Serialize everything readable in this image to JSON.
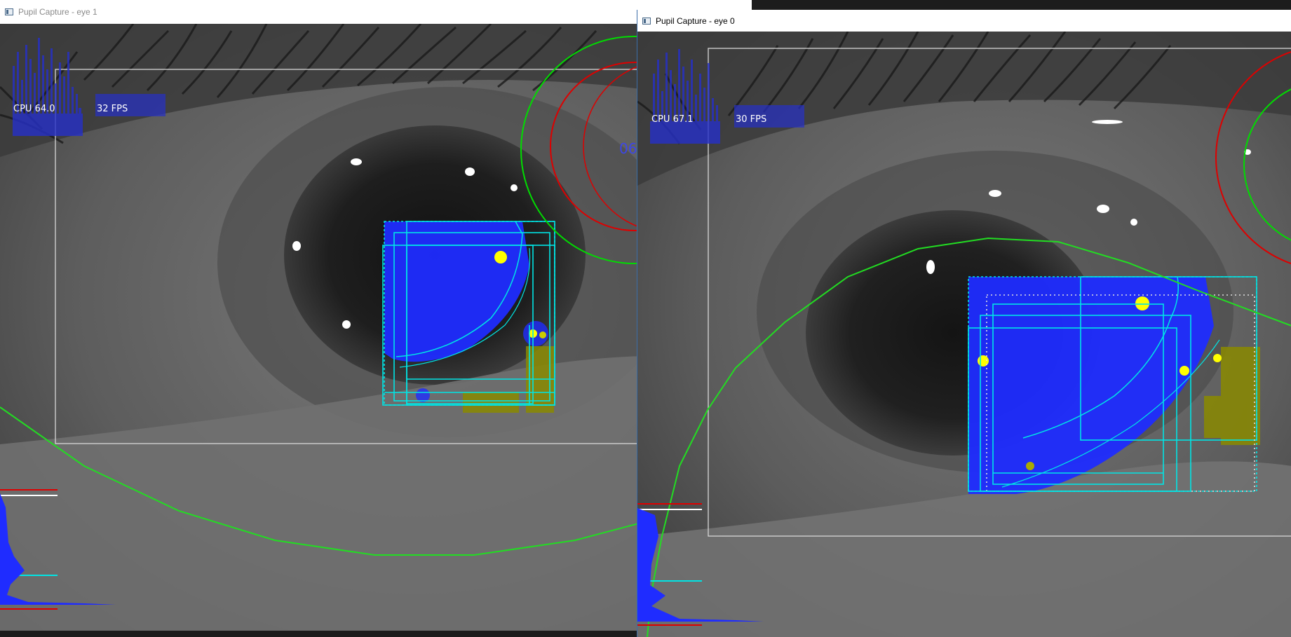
{
  "windows": {
    "eye1": {
      "title": "Pupil Capture - eye 1",
      "cpu_label": "CPU 64.0",
      "fps_label": "32 FPS",
      "clipped_text": "06"
    },
    "eye0": {
      "title": "Pupil Capture - eye 0",
      "cpu_label": "CPU 67.1",
      "fps_label": "30 FPS"
    }
  },
  "colors": {
    "pupil_fill": "#1f2cff",
    "roi_box": "#00e5e5",
    "glint": "#ffff00",
    "eye_model_circle": "#00dd00",
    "outer_circle": "#dd0000",
    "histogram": "#2630c8"
  },
  "icons": [
    "app-window-icon"
  ]
}
